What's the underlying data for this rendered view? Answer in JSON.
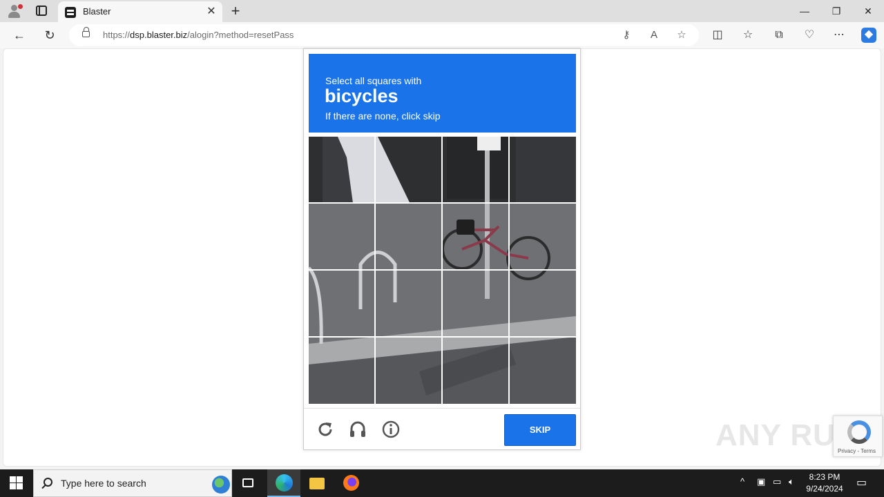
{
  "browser": {
    "tab_title": "Blaster",
    "url_prefix": "https://",
    "url_host": "dsp.blaster.biz",
    "url_path": "/alogin?method=resetPass"
  },
  "captcha": {
    "instruction_line1": "Select all squares with",
    "target_word": "bicycles",
    "instruction_line3": "If there are none, click skip",
    "skip_label": "SKIP",
    "grid_rows": 4,
    "grid_cols": 4
  },
  "recaptcha_badge": {
    "terms": "Privacy - Terms"
  },
  "watermark": "ANY RUN",
  "taskbar": {
    "search_placeholder": "Type here to search",
    "time": "8:23 PM",
    "date": "9/24/2024"
  },
  "colors": {
    "accent": "#1a73e8"
  }
}
